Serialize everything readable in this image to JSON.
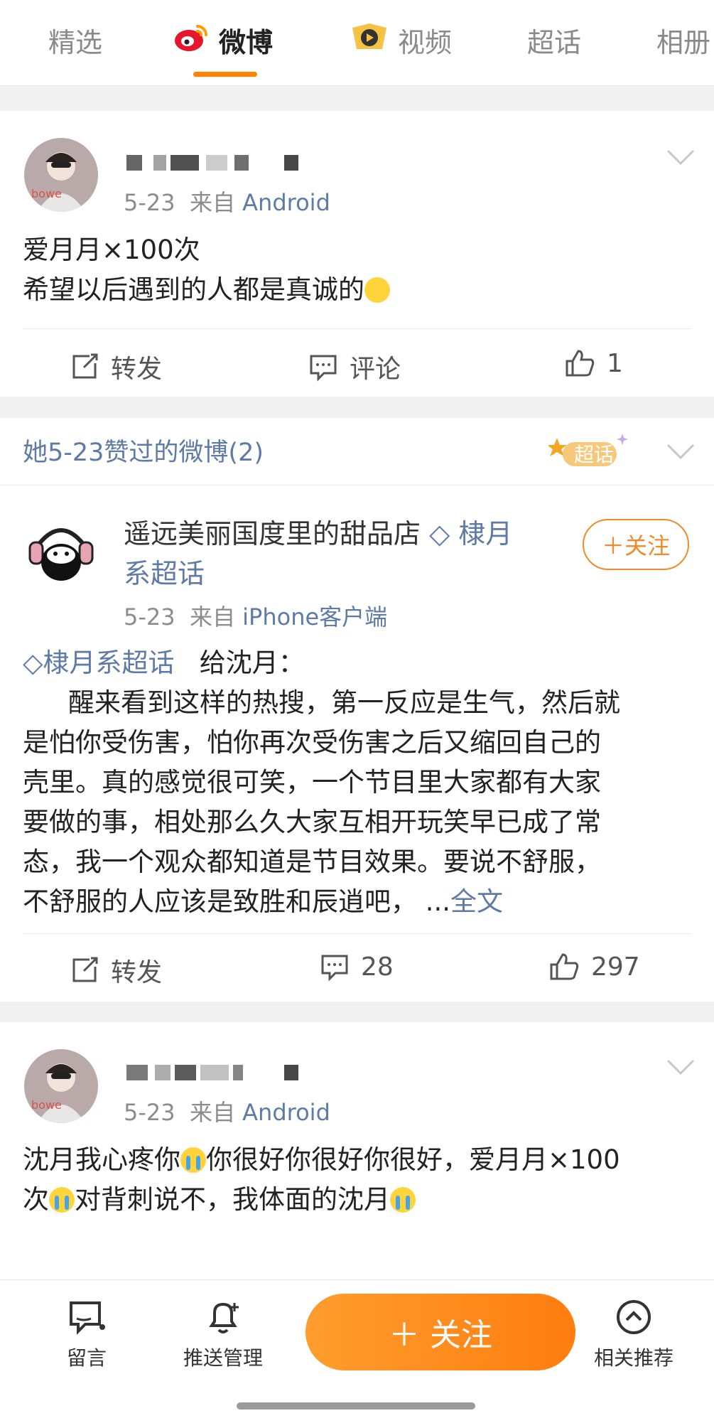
{
  "tabs": [
    {
      "label": "精选",
      "active": false
    },
    {
      "label": "微博",
      "active": true
    },
    {
      "label": "视频",
      "active": false
    },
    {
      "label": "超话",
      "active": false
    },
    {
      "label": "相册",
      "active": false
    }
  ],
  "posts": [
    {
      "date": "5-23",
      "source_prefix": "来自",
      "source": "Android",
      "line1": "爱月月×100次",
      "line2": "希望以后遇到的人都是真诚的",
      "repost_label": "转发",
      "comment_label": "评论",
      "like_count": "1"
    },
    {
      "author": "遥远美丽国度里的甜品店",
      "author_topic": "棣月",
      "author_topic2": "系超话",
      "follow_label": "＋关注",
      "date": "5-23",
      "source_prefix": "来自",
      "source": "iPhone客户端",
      "topic": "棣月系超话",
      "intro": "给沈月：",
      "lines": [
        "醒来看到这样的热搜，第一反应是生气，然后就",
        "是怕你受伤害，怕你再次受伤害之后又缩回自己的",
        "壳里。真的感觉很可笑，一个节目里大家都有大家",
        "要做的事，相处那么久大家互相开玩笑早已成了常",
        "态，我一个观众都知道是节目效果。要说不舒服，",
        "不舒服的人应该是致胜和辰逍吧，  ..."
      ],
      "more": "全文",
      "repost_label": "转发",
      "comment_count": "28",
      "like_count": "297"
    },
    {
      "date": "5-23",
      "source_prefix": "来自",
      "source": "Android",
      "line1a": "沈月我心疼你",
      "line1b": "你很好你很好你很好，爱月月×100",
      "line2a": "次",
      "line2b": "对背刺说不，我体面的沈月"
    }
  ],
  "liked_section": {
    "title": "她5-23赞过的微博(2)",
    "badge": "超话"
  },
  "bottom": {
    "message_label": "留言",
    "push_label": "推送管理",
    "follow_label": "＋ 关注",
    "related_label": "相关推荐"
  },
  "colors": {
    "accent": "#ff8200",
    "link": "#5e7aa6"
  }
}
